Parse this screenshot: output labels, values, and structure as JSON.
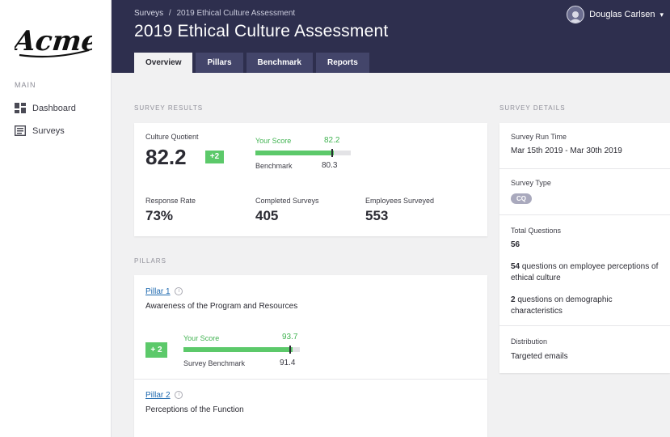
{
  "brand": {
    "logo_text": "Acme"
  },
  "sidebar": {
    "section": "MAIN",
    "items": [
      {
        "label": "Dashboard",
        "icon": "dashboard-grid-icon"
      },
      {
        "label": "Surveys",
        "icon": "surveys-list-icon"
      }
    ]
  },
  "header": {
    "breadcrumb": {
      "root": "Surveys",
      "sep": "/",
      "current": "2019 Ethical Culture Assessment"
    },
    "title": "2019 Ethical Culture Assessment",
    "user": {
      "name": "Douglas Carlsen",
      "caret": "▾"
    },
    "tabs": [
      {
        "label": "Overview",
        "active": true
      },
      {
        "label": "Pillars"
      },
      {
        "label": "Benchmark"
      },
      {
        "label": "Reports"
      }
    ]
  },
  "survey_results": {
    "section": "SURVEY RESULTS",
    "culture_quotient": {
      "label": "Culture Quotient",
      "value": "82.2",
      "delta": "+2"
    },
    "your_score": {
      "label": "Your Score",
      "value": "82.2",
      "fraction": 0.822
    },
    "benchmark": {
      "label": "Benchmark",
      "value": "80.3",
      "fraction": 0.803
    },
    "response_rate": {
      "label": "Response Rate",
      "value": "73%"
    },
    "completed": {
      "label": "Completed Surveys",
      "value": "405"
    },
    "employees": {
      "label": "Employees Surveyed",
      "value": "553"
    }
  },
  "pillars": {
    "section": "PILLARS",
    "items": [
      {
        "link": "Pillar 1",
        "name": "Awareness of the Program and Resources",
        "delta": "+ 2",
        "score_label": "Your Score",
        "score": "93.7",
        "score_fraction": 0.937,
        "bench_label": "Survey Benchmark",
        "bench": "91.4",
        "bench_fraction": 0.914
      },
      {
        "link": "Pillar 2",
        "name": "Perceptions of the Function"
      }
    ]
  },
  "survey_details": {
    "section": "SURVEY DETAILS",
    "run_time": {
      "label": "Survey Run Time",
      "value": "Mar 15th 2019 - Mar 30th 2019"
    },
    "type": {
      "label": "Survey Type",
      "value": "CQ"
    },
    "questions": {
      "label": "Total Questions",
      "value": "56",
      "line1_num": "54",
      "line1_text": " questions on employee perceptions of ethical culture",
      "line2_num": "2",
      "line2_text": " questions on demographic characteristics"
    },
    "distribution": {
      "label": "Distribution",
      "value": "Targeted emails"
    }
  },
  "colors": {
    "header": "#2e2f4e",
    "accent_green": "#5cc96a",
    "link": "#1f6ab0"
  }
}
